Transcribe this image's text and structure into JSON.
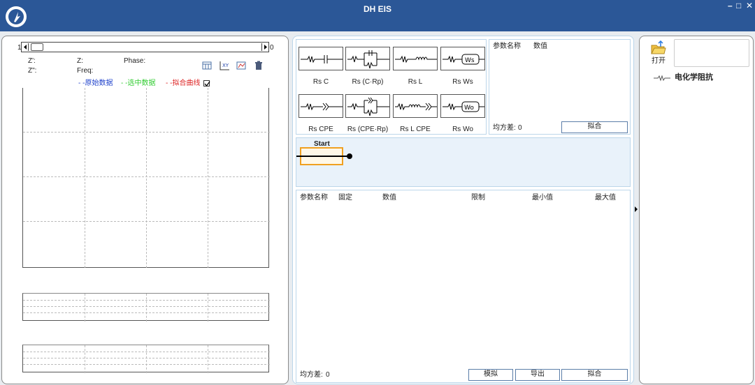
{
  "window": {
    "title": "DH EIS",
    "minimize": "–",
    "maximize": "□",
    "close": "✕"
  },
  "left_panel": {
    "slider": {
      "min_label": "1",
      "max_label": "0"
    },
    "readouts": {
      "z_real": "Z':",
      "z": "Z:",
      "phase": "Phase:",
      "z_imag": "Z\":",
      "freq": "Freq:"
    },
    "legend": {
      "raw": {
        "prefix": "- -",
        "label": "原始数据",
        "color": "#2244cc"
      },
      "selected": {
        "prefix": "- -",
        "label": "选中数据",
        "color": "#33cc33"
      },
      "fit": {
        "prefix": "- -",
        "label": "拟合曲线",
        "color": "#dd2222"
      },
      "fit_checked": true
    },
    "toolbar_icons": [
      "table-icon",
      "xy-chart-icon",
      "bode-chart-icon",
      "trash-icon"
    ]
  },
  "circuits": [
    {
      "label": "Rs C",
      "icon": "rs-c-circuit-icon"
    },
    {
      "label": "Rs (C·Rp)",
      "icon": "rs-c-rp-circuit-icon"
    },
    {
      "label": "Rs L",
      "icon": "rs-l-circuit-icon"
    },
    {
      "label": "Rs Ws",
      "icon": "rs-ws-circuit-icon"
    },
    {
      "label": "Rs CPE",
      "icon": "rs-cpe-circuit-icon"
    },
    {
      "label": "Rs (CPE·Rp)",
      "icon": "rs-cpe-rp-circuit-icon"
    },
    {
      "label": "Rs L CPE",
      "icon": "rs-l-cpe-circuit-icon"
    },
    {
      "label": "Rs Wo",
      "icon": "rs-wo-circuit-icon"
    }
  ],
  "params_top": {
    "col_name": "参数名称",
    "col_value": "数值",
    "variance_label": "均方差:",
    "variance_value": "0",
    "fit_button": "拟合"
  },
  "diagram": {
    "start_label": "Start"
  },
  "params_bottom": {
    "columns": [
      "参数名称",
      "固定",
      "数值",
      "限制",
      "最小值",
      "最大值"
    ],
    "variance_label": "均方差:",
    "variance_value": "0",
    "simulate_button": "模拟",
    "export_button": "导出",
    "fit_button": "拟合"
  },
  "right_panel": {
    "open_label": "打开",
    "tree_item": "电化学阻抗"
  }
}
